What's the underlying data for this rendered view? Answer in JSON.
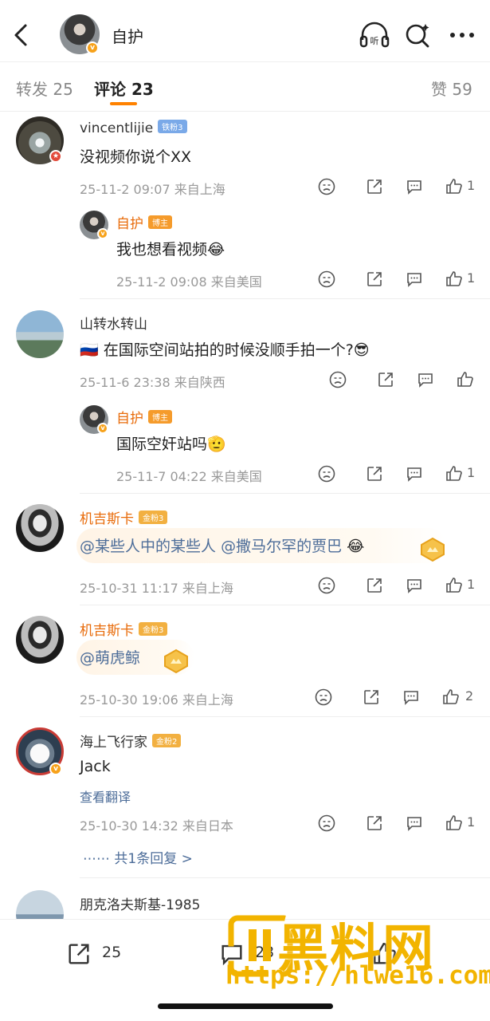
{
  "header": {
    "title": "自护"
  },
  "tabs": [
    {
      "label": "转发 25"
    },
    {
      "label": "评论 23"
    },
    {
      "label": "赞 59"
    }
  ],
  "comments": [
    {
      "user": "vincentlijie",
      "badge": "铁粉3",
      "text": "没视频你说个XX",
      "meta": "25-11-2 09:07  来自上海",
      "likes": "1",
      "reply": {
        "user": "自护",
        "badge": "博主",
        "text": "我也想看视频😂",
        "meta": "25-11-2 09:08  来自美国",
        "likes": "1"
      }
    },
    {
      "user": "山转水转山",
      "text": "🇷🇺 在国际空间站拍的时候没顺手拍一个?😎",
      "meta": "25-11-6 23:38  来自陕西",
      "likes": "",
      "reply": {
        "user": "自护",
        "badge": "博主",
        "text": "国际空奸站吗🫡",
        "meta": "25-11-7 04:22  来自美国",
        "likes": "1"
      }
    },
    {
      "user": "机吉斯卡",
      "badge": "金粉3",
      "mention1": "@某些人中的某些人",
      "mention2": "@撒马尔罕的贾巴",
      "emoji": "😂",
      "meta": "25-10-31 11:17  来自上海",
      "likes": "1"
    },
    {
      "user": "机吉斯卡",
      "badge": "金粉3",
      "mention1": "@萌虎鲸",
      "meta": "25-10-30 19:06  来自上海",
      "likes": "2"
    },
    {
      "user": "海上飞行家",
      "badge": "金粉2",
      "text": "Jack",
      "translate": "查看翻译",
      "meta": "25-10-30 14:32  来自日本",
      "likes": "1",
      "more": "⋯⋯  共1条回复 >"
    },
    {
      "user": "朋克洛夫斯基-1985"
    }
  ],
  "bottom": {
    "repost_count": "25",
    "comment_count": "23"
  },
  "watermark": {
    "title": "黑料网",
    "url": "https://hlwe16.com"
  },
  "colors": {
    "accent": "#ff8200",
    "link": "#4d6d99",
    "watermark": "#f2b400"
  }
}
